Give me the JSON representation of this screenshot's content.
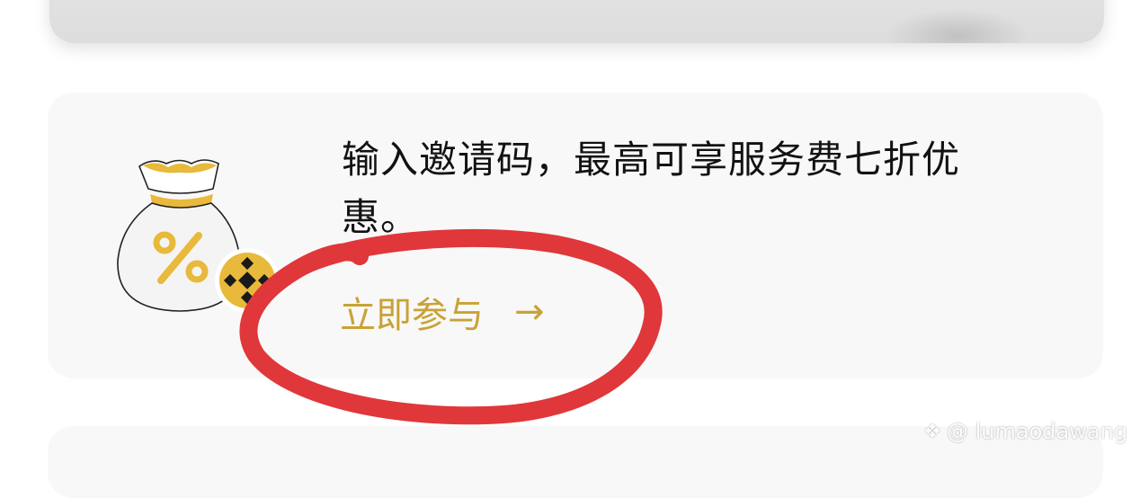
{
  "promo": {
    "text": "输入邀请码，最高可享服务费七折优惠。",
    "link_label": "立即参与",
    "arrow": "→"
  },
  "icons": {
    "bag": "money-bag-percent-icon",
    "badge": "binance-logo-icon",
    "arrow": "arrow-right-icon"
  },
  "watermark": {
    "text": "@ lumaodawang"
  },
  "colors": {
    "accent": "#c9a237",
    "bag_gold": "#e8b93a",
    "annotation_red": "#e0373a",
    "card_bg": "#f8f8f8"
  }
}
